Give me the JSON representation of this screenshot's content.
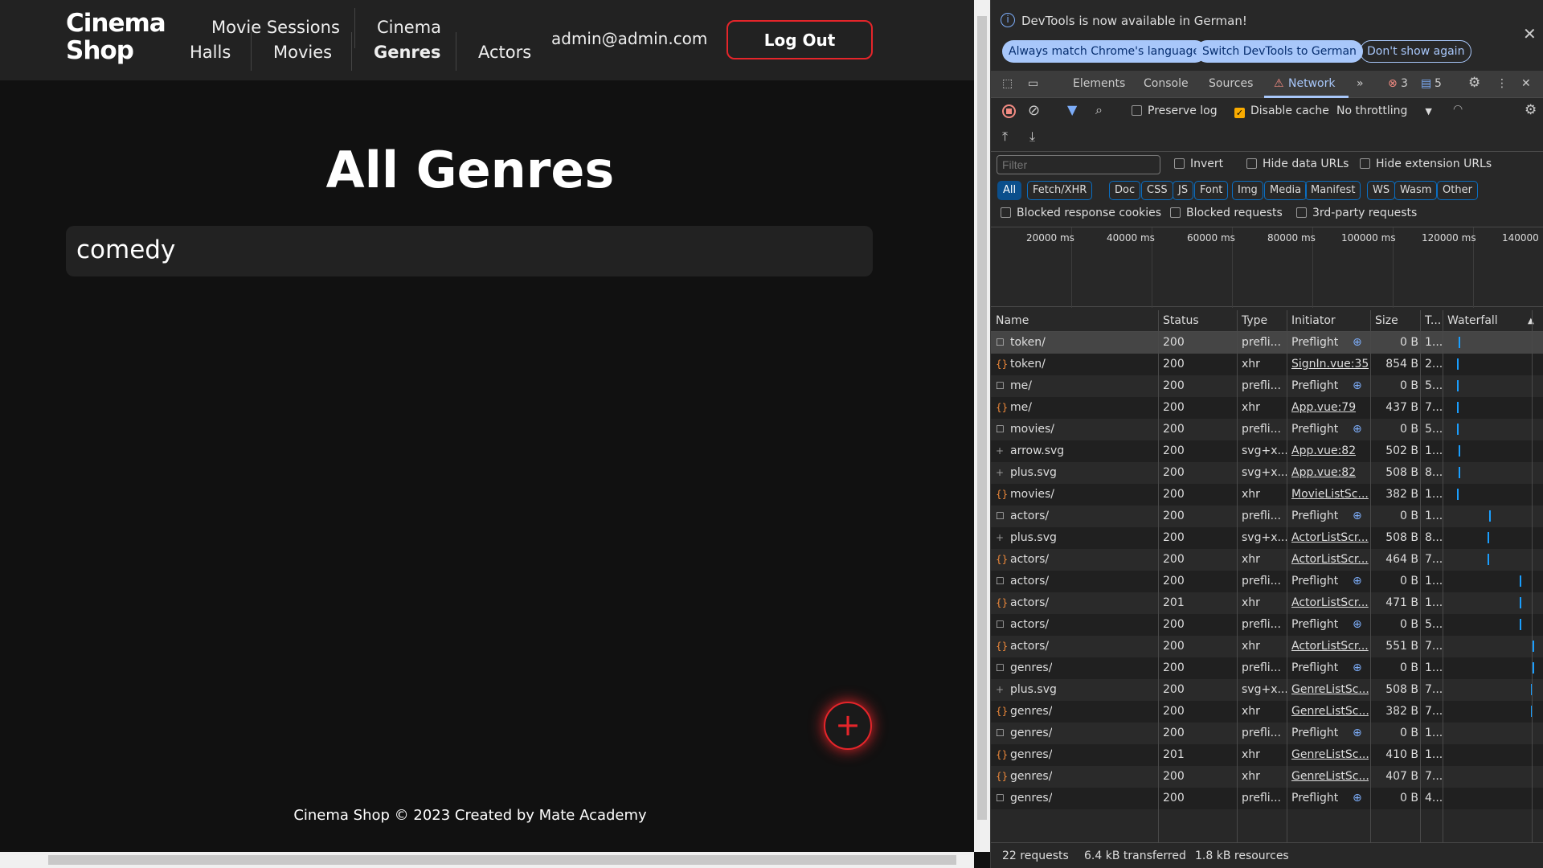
{
  "app": {
    "logo_line1": "Cinema",
    "logo_line2": "Shop",
    "nav": {
      "movie_sessions": "Movie Sessions",
      "cinema": "Cinema",
      "halls": "Halls",
      "movies": "Movies",
      "genres": "Genres",
      "actors": "Actors"
    },
    "email": "admin@admin.com",
    "logout": "Log Out",
    "title": "All Genres",
    "genres": [
      "comedy"
    ],
    "add_icon": "+",
    "footer": "Cinema Shop © 2023 Created by Mate Academy",
    "accent": "#e5252a"
  },
  "devtools": {
    "info": "DevTools is now available in German!",
    "info_buttons": [
      "Always match Chrome's language",
      "Switch DevTools to German",
      "Don't show again"
    ],
    "tabs": [
      "Elements",
      "Console",
      "Sources",
      "Network"
    ],
    "errors": "3",
    "messages": "5",
    "preserve_log": "Preserve log",
    "disable_cache": "Disable cache",
    "throttling": "No throttling",
    "filter_placeholder": "Filter",
    "invert": "Invert",
    "hide_data": "Hide data URLs",
    "hide_ext": "Hide extension URLs",
    "types": [
      "All",
      "Fetch/XHR",
      "Doc",
      "CSS",
      "JS",
      "Font",
      "Img",
      "Media",
      "Manifest",
      "WS",
      "Wasm",
      "Other"
    ],
    "blocked": [
      "Blocked response cookies",
      "Blocked requests",
      "3rd-party requests"
    ],
    "timeline": [
      "20000 ms",
      "40000 ms",
      "60000 ms",
      "80000 ms",
      "100000 ms",
      "120000 ms",
      "140000"
    ],
    "columns": [
      "Name",
      "Status",
      "Type",
      "Initiator",
      "Size",
      "T...",
      "Waterfall"
    ],
    "rows": [
      {
        "icon": "preflight",
        "name": "token/",
        "status": "200",
        "type": "prefli...",
        "initiator": "Preflight",
        "size": "0 B",
        "time": "1..."
      },
      {
        "icon": "xhr",
        "name": "token/",
        "status": "200",
        "type": "xhr",
        "initiator": "SignIn.vue:35",
        "size": "854 B",
        "time": "2..."
      },
      {
        "icon": "preflight",
        "name": "me/",
        "status": "200",
        "type": "prefli...",
        "initiator": "Preflight",
        "size": "0 B",
        "time": "5..."
      },
      {
        "icon": "xhr",
        "name": "me/",
        "status": "200",
        "type": "xhr",
        "initiator": "App.vue:79",
        "size": "437 B",
        "time": "7..."
      },
      {
        "icon": "preflight",
        "name": "movies/",
        "status": "200",
        "type": "prefli...",
        "initiator": "Preflight",
        "size": "0 B",
        "time": "5..."
      },
      {
        "icon": "svg",
        "name": "arrow.svg",
        "status": "200",
        "type": "svg+x...",
        "initiator": "App.vue:82",
        "size": "502 B",
        "time": "1..."
      },
      {
        "icon": "svg",
        "name": "plus.svg",
        "status": "200",
        "type": "svg+x...",
        "initiator": "App.vue:82",
        "size": "508 B",
        "time": "8..."
      },
      {
        "icon": "xhr",
        "name": "movies/",
        "status": "200",
        "type": "xhr",
        "initiator": "MovieListSc...",
        "size": "382 B",
        "time": "1..."
      },
      {
        "icon": "preflight",
        "name": "actors/",
        "status": "200",
        "type": "prefli...",
        "initiator": "Preflight",
        "size": "0 B",
        "time": "1..."
      },
      {
        "icon": "svg",
        "name": "plus.svg",
        "status": "200",
        "type": "svg+x...",
        "initiator": "ActorListScr...",
        "size": "508 B",
        "time": "8..."
      },
      {
        "icon": "xhr",
        "name": "actors/",
        "status": "200",
        "type": "xhr",
        "initiator": "ActorListScr...",
        "size": "464 B",
        "time": "7..."
      },
      {
        "icon": "preflight",
        "name": "actors/",
        "status": "200",
        "type": "prefli...",
        "initiator": "Preflight",
        "size": "0 B",
        "time": "1..."
      },
      {
        "icon": "xhr",
        "name": "actors/",
        "status": "201",
        "type": "xhr",
        "initiator": "ActorListScr...",
        "size": "471 B",
        "time": "1..."
      },
      {
        "icon": "preflight",
        "name": "actors/",
        "status": "200",
        "type": "prefli...",
        "initiator": "Preflight",
        "size": "0 B",
        "time": "5..."
      },
      {
        "icon": "xhr",
        "name": "actors/",
        "status": "200",
        "type": "xhr",
        "initiator": "ActorListScr...",
        "size": "551 B",
        "time": "7..."
      },
      {
        "icon": "preflight",
        "name": "genres/",
        "status": "200",
        "type": "prefli...",
        "initiator": "Preflight",
        "size": "0 B",
        "time": "1..."
      },
      {
        "icon": "svg",
        "name": "plus.svg",
        "status": "200",
        "type": "svg+x...",
        "initiator": "GenreListSc...",
        "size": "508 B",
        "time": "7..."
      },
      {
        "icon": "xhr",
        "name": "genres/",
        "status": "200",
        "type": "xhr",
        "initiator": "GenreListSc...",
        "size": "382 B",
        "time": "7..."
      },
      {
        "icon": "preflight",
        "name": "genres/",
        "status": "200",
        "type": "prefli...",
        "initiator": "Preflight",
        "size": "0 B",
        "time": "1..."
      },
      {
        "icon": "xhr",
        "name": "genres/",
        "status": "201",
        "type": "xhr",
        "initiator": "GenreListSc...",
        "size": "410 B",
        "time": "1..."
      },
      {
        "icon": "xhr",
        "name": "genres/",
        "status": "200",
        "type": "xhr",
        "initiator": "GenreListSc...",
        "size": "407 B",
        "time": "7..."
      },
      {
        "icon": "preflight",
        "name": "genres/",
        "status": "200",
        "type": "prefli...",
        "initiator": "Preflight",
        "size": "0 B",
        "time": "4..."
      }
    ],
    "summary": [
      "22 requests",
      "6.4 kB transferred",
      "1.8 kB resources"
    ]
  }
}
